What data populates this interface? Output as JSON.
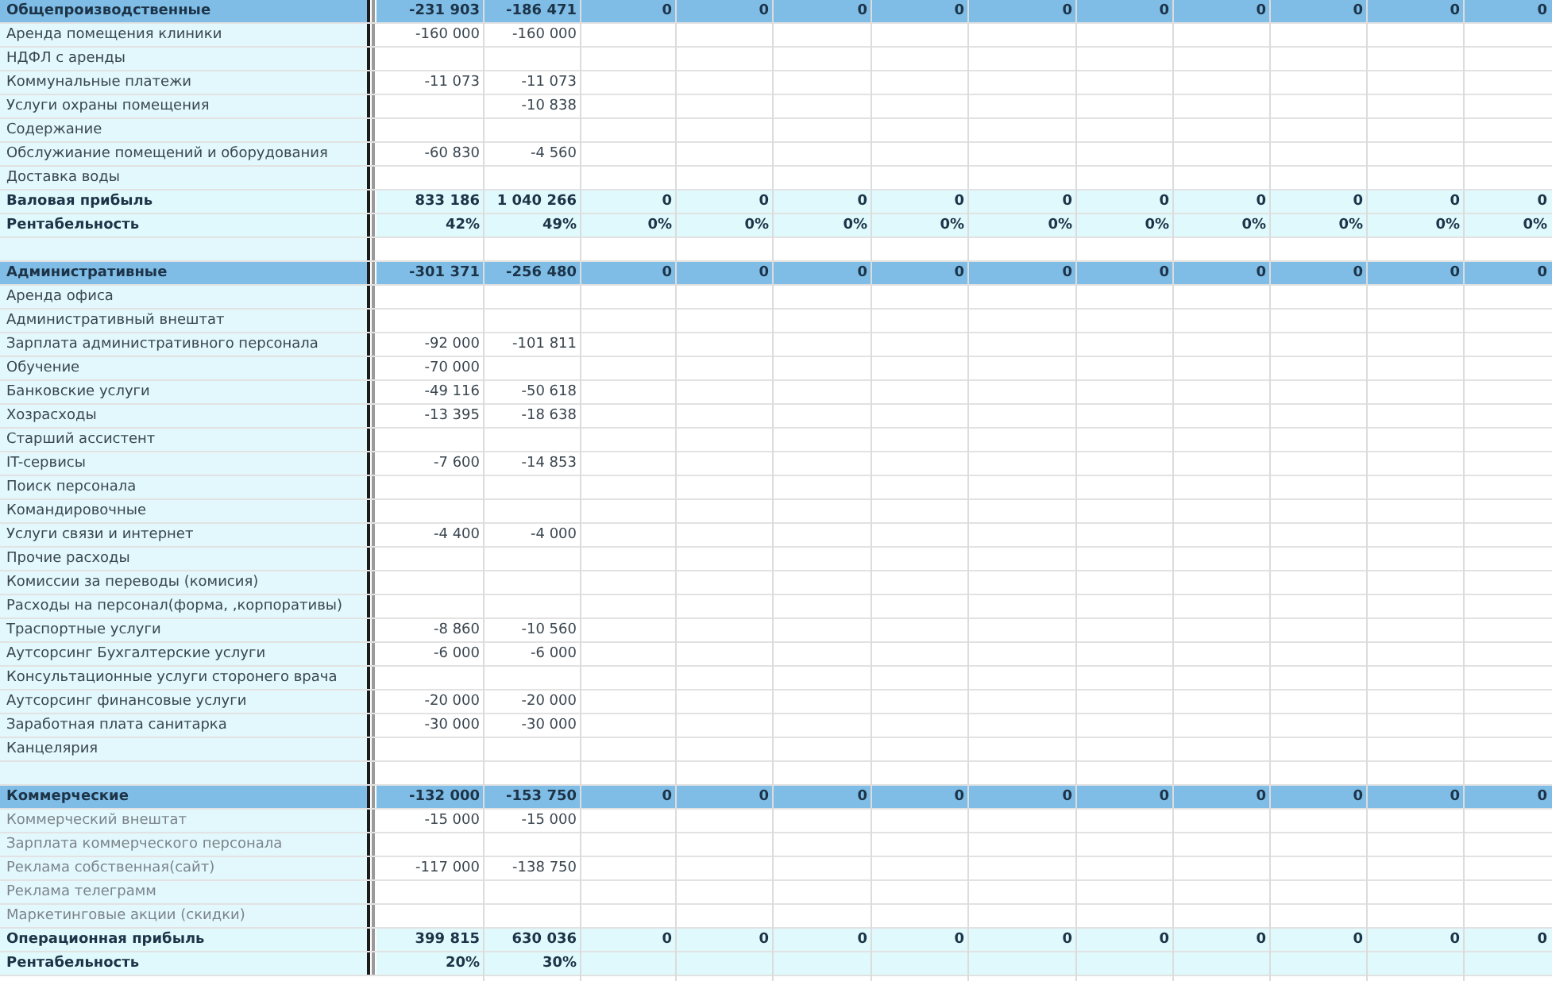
{
  "rows": [
    {
      "kind": "section",
      "label": "Общепроизводственные",
      "values": {
        "column_1": "-231 903",
        "column_2": "-186 471",
        "column_3": "0",
        "column_4": "0",
        "column_5": "0",
        "column_6": "0",
        "column_7": "0",
        "column_8": "0",
        "column_9": "0",
        "column_10": "0",
        "column_11": "0",
        "column_12": "0"
      }
    },
    {
      "kind": "item",
      "label": "Аренда помещения клиники",
      "values": {
        "column_1": "-160 000",
        "column_2": "-160 000"
      }
    },
    {
      "kind": "item",
      "label": "НДФЛ с аренды"
    },
    {
      "kind": "item",
      "label": "Коммунальные платежи",
      "values": {
        "column_1": "-11 073",
        "column_2": "-11 073"
      }
    },
    {
      "kind": "item",
      "label": "Услуги охраны помещения",
      "values": {
        "column_2": "-10 838"
      }
    },
    {
      "kind": "item",
      "label": "Содержание"
    },
    {
      "kind": "item",
      "label": "Обслужиание помещений и оборудования",
      "values": {
        "column_1": "-60 830",
        "column_2": "-4 560"
      }
    },
    {
      "kind": "item",
      "label": "Доставка воды"
    },
    {
      "kind": "total",
      "label": "Валовая прибыль",
      "values": {
        "column_1": "833 186",
        "column_2": "1 040 266",
        "column_3": "0",
        "column_4": "0",
        "column_5": "0",
        "column_6": "0",
        "column_7": "0",
        "column_8": "0",
        "column_9": "0",
        "column_10": "0",
        "column_11": "0",
        "column_12": "0"
      }
    },
    {
      "kind": "total",
      "label": "Рентабельность",
      "values": {
        "column_1": "42%",
        "column_2": "49%",
        "column_3": "0%",
        "column_4": "0%",
        "column_5": "0%",
        "column_6": "0%",
        "column_7": "0%",
        "column_8": "0%",
        "column_9": "0%",
        "column_10": "0%",
        "column_11": "0%",
        "column_12": "0%"
      }
    },
    {
      "kind": "blank"
    },
    {
      "kind": "section",
      "label": "Административные",
      "values": {
        "column_1": "-301 371",
        "column_2": "-256 480",
        "column_3": "0",
        "column_4": "0",
        "column_5": "0",
        "column_6": "0",
        "column_7": "0",
        "column_8": "0",
        "column_9": "0",
        "column_10": "0",
        "column_11": "0",
        "column_12": "0"
      }
    },
    {
      "kind": "item",
      "label": "Аренда офиса"
    },
    {
      "kind": "item",
      "label": "Административный внештат"
    },
    {
      "kind": "item",
      "label": "Зарплата административного персонала",
      "values": {
        "column_1": "-92 000",
        "column_2": "-101 811"
      }
    },
    {
      "kind": "item",
      "label": "Обучение",
      "values": {
        "column_1": "-70 000"
      }
    },
    {
      "kind": "item",
      "label": "Банковские услуги",
      "values": {
        "column_1": "-49 116",
        "column_2": "-50 618"
      }
    },
    {
      "kind": "item",
      "label": "Хозрасходы",
      "values": {
        "column_1": "-13 395",
        "column_2": "-18 638"
      }
    },
    {
      "kind": "item",
      "label": "Старший ассистент"
    },
    {
      "kind": "item",
      "label": "IT-сервисы",
      "values": {
        "column_1": "-7 600",
        "column_2": "-14 853"
      }
    },
    {
      "kind": "item",
      "label": "Поиск персонала"
    },
    {
      "kind": "item",
      "label": "Командировочные"
    },
    {
      "kind": "item",
      "label": "Услуги связи и интернет",
      "values": {
        "column_1": "-4 400",
        "column_2": "-4 000"
      }
    },
    {
      "kind": "item",
      "label": "Прочие расходы"
    },
    {
      "kind": "item",
      "label": "Комиссии за переводы (комисия)"
    },
    {
      "kind": "item",
      "label": "Расходы на персонал(форма, ,корпоративы)"
    },
    {
      "kind": "item",
      "label": "Траспортные услуги",
      "values": {
        "column_1": "-8 860",
        "column_2": "-10 560"
      }
    },
    {
      "kind": "item",
      "label": "Аутсорсинг Бухгалтерские услуги",
      "values": {
        "column_1": "-6 000",
        "column_2": "-6 000"
      }
    },
    {
      "kind": "item",
      "label": "Консультационные услуги сторонего врача"
    },
    {
      "kind": "item",
      "label": "Аутсорсинг финансовые услуги",
      "values": {
        "column_1": "-20 000",
        "column_2": "-20 000"
      }
    },
    {
      "kind": "item",
      "label": "Заработная плата санитарка",
      "values": {
        "column_1": "-30 000",
        "column_2": "-30 000"
      }
    },
    {
      "kind": "item",
      "label": "Канцелярия"
    },
    {
      "kind": "blank"
    },
    {
      "kind": "section",
      "label": "Коммерческие",
      "values": {
        "column_1": "-132 000",
        "column_2": "-153 750",
        "column_3": "0",
        "column_4": "0",
        "column_5": "0",
        "column_6": "0",
        "column_7": "0",
        "column_8": "0",
        "column_9": "0",
        "column_10": "0",
        "column_11": "0",
        "column_12": "0"
      }
    },
    {
      "kind": "faint",
      "label": "Коммерческий внештат",
      "values": {
        "column_1": "-15 000",
        "column_2": "-15 000"
      }
    },
    {
      "kind": "faint",
      "label": "Зарплата коммерческого персонала"
    },
    {
      "kind": "faint",
      "label": "Реклама собственная(сайт)",
      "values": {
        "column_1": "-117 000",
        "column_2": "-138 750"
      }
    },
    {
      "kind": "faint",
      "label": "Реклама телеграмм"
    },
    {
      "kind": "faint",
      "label": "Маркетинговые акции (скидки)"
    },
    {
      "kind": "total",
      "label": "Операционная прибыль",
      "values": {
        "column_1": "399 815",
        "column_2": "630 036",
        "column_3": "0",
        "column_4": "0",
        "column_5": "0",
        "column_6": "0",
        "column_7": "0",
        "column_8": "0",
        "column_9": "0",
        "column_10": "0",
        "column_11": "0",
        "column_12": "0"
      }
    },
    {
      "kind": "total",
      "label": "Рентабельность",
      "values": {
        "column_1": "20%",
        "column_2": "30%"
      }
    }
  ]
}
